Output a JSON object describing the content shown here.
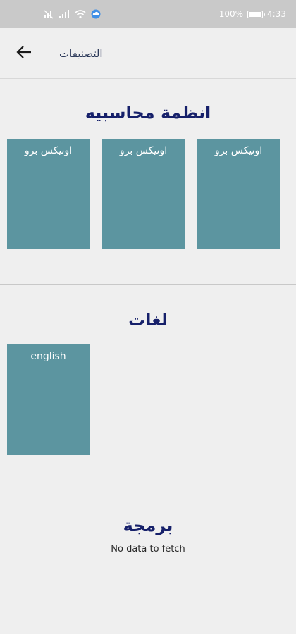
{
  "status_bar": {
    "battery": "100%",
    "time": "4:33"
  },
  "app_bar": {
    "title": "التصنيفات",
    "back_icon": "arrow-left-icon"
  },
  "sections": [
    {
      "title": "انظمة محاسبيه",
      "items": [
        "اونيكس برو",
        "اونيكس برو",
        "اونيكس برو"
      ]
    },
    {
      "title": "لغات",
      "items": [
        "english"
      ]
    },
    {
      "title": "برمجة",
      "empty_message": "No data to fetch"
    }
  ],
  "colors": {
    "card": "#5c95a0",
    "heading": "#16206a",
    "status_bar": "#c9c9c9",
    "background": "#efefef"
  }
}
